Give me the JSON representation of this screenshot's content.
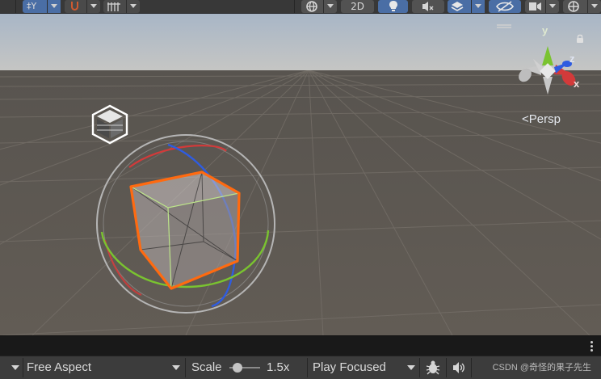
{
  "toolbar": {
    "pivot_label": "‡Y",
    "toggle_2d_label": "2D"
  },
  "scene": {
    "perspective_label": "<Persp",
    "gizmo": {
      "y_label": "y",
      "z_label": "z",
      "x_label": "x"
    }
  },
  "game_bar": {
    "aspect": "Free Aspect",
    "scale_label": "Scale",
    "scale_value": "1.5x",
    "scale_fraction": 0.25,
    "play_mode": "Play Focused",
    "watermark": "CSDN @奇怪的果子先生"
  },
  "colors": {
    "sky_top": "#a8b6c6",
    "ground": "#5f5a54",
    "selection": "#ff6a10",
    "axis_x": "#d23a3a",
    "axis_y": "#7ac330",
    "axis_z": "#2f5ce0",
    "active_button": "#4a6ea5"
  },
  "icons": [
    "pivot-icon",
    "magnet-icon",
    "grid-snap-icon",
    "globe-icon",
    "light-icon",
    "audio-mute-icon",
    "layers-icon",
    "visibility-icon",
    "camera-icon",
    "gizmos-icon",
    "lock-icon",
    "bug-icon",
    "speaker-icon",
    "gameobject-icon"
  ]
}
